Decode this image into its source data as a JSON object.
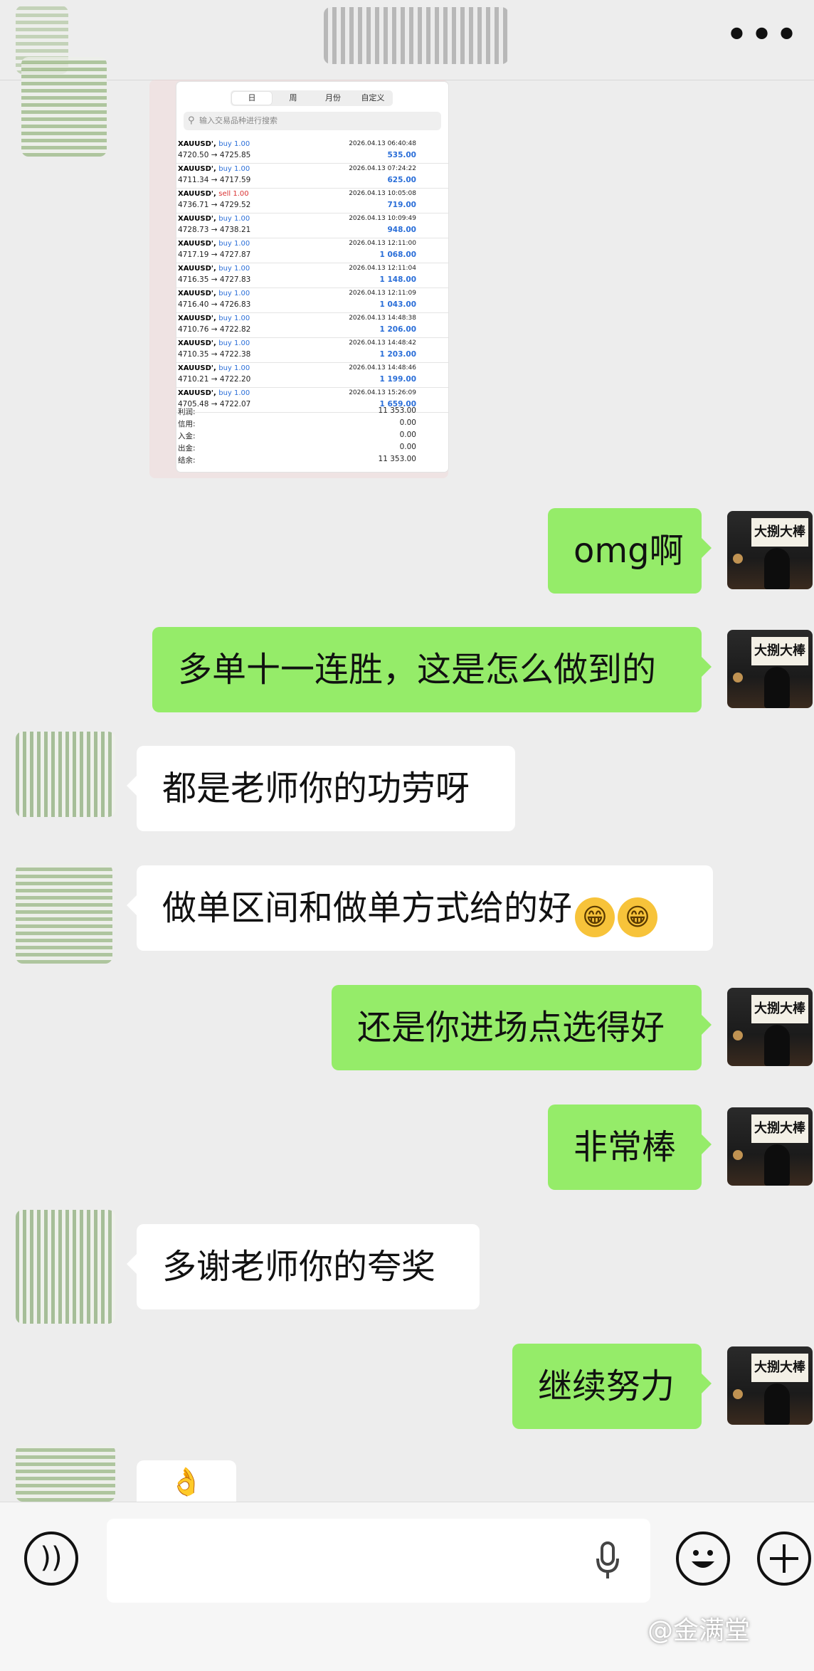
{
  "topbar": {
    "more_icon": "more-dots-icon",
    "more_label": "•••"
  },
  "trade_image": {
    "tabs": [
      "日",
      "周",
      "月份",
      "自定义"
    ],
    "search_placeholder": "输入交易品种进行搜索",
    "trades": [
      {
        "symbol": "XAUUSD',",
        "side": "buy 1.00",
        "prices": "4720.50 → 4725.85",
        "time": "2026.04.13 06:40:48",
        "profit": "535.00"
      },
      {
        "symbol": "XAUUSD',",
        "side": "buy 1.00",
        "prices": "4711.34 → 4717.59",
        "time": "2026.04.13 07:24:22",
        "profit": "625.00"
      },
      {
        "symbol": "XAUUSD',",
        "side": "sell 1.00",
        "prices": "4736.71 → 4729.52",
        "time": "2026.04.13 10:05:08",
        "profit": "719.00"
      },
      {
        "symbol": "XAUUSD',",
        "side": "buy 1.00",
        "prices": "4728.73 → 4738.21",
        "time": "2026.04.13 10:09:49",
        "profit": "948.00"
      },
      {
        "symbol": "XAUUSD',",
        "side": "buy 1.00",
        "prices": "4717.19 → 4727.87",
        "time": "2026.04.13 12:11:00",
        "profit": "1 068.00"
      },
      {
        "symbol": "XAUUSD',",
        "side": "buy 1.00",
        "prices": "4716.35 → 4727.83",
        "time": "2026.04.13 12:11:04",
        "profit": "1 148.00"
      },
      {
        "symbol": "XAUUSD',",
        "side": "buy 1.00",
        "prices": "4716.40 → 4726.83",
        "time": "2026.04.13 12:11:09",
        "profit": "1 043.00"
      },
      {
        "symbol": "XAUUSD',",
        "side": "buy 1.00",
        "prices": "4710.76 → 4722.82",
        "time": "2026.04.13 14:48:38",
        "profit": "1 206.00"
      },
      {
        "symbol": "XAUUSD',",
        "side": "buy 1.00",
        "prices": "4710.35 → 4722.38",
        "time": "2026.04.13 14:48:42",
        "profit": "1 203.00"
      },
      {
        "symbol": "XAUUSD',",
        "side": "buy 1.00",
        "prices": "4710.21 → 4722.20",
        "time": "2026.04.13 14:48:46",
        "profit": "1 199.00"
      },
      {
        "symbol": "XAUUSD',",
        "side": "buy 1.00",
        "prices": "4705.48 → 4722.07",
        "time": "2026.04.13 15:26:09",
        "profit": "1 659.00"
      }
    ],
    "summary": [
      {
        "label": "利润:",
        "value": "11 353.00"
      },
      {
        "label": "信用:",
        "value": "0.00"
      },
      {
        "label": "入金:",
        "value": "0.00"
      },
      {
        "label": "出金:",
        "value": "0.00"
      },
      {
        "label": "结余:",
        "value": "11 353.00"
      }
    ]
  },
  "my_avatar_sign": "大捌大棒",
  "messages": [
    {
      "from": "me",
      "text": "omg啊"
    },
    {
      "from": "me",
      "text": "多单十一连胜，这是怎么做到的"
    },
    {
      "from": "other",
      "text": "都是老师你的功劳呀"
    },
    {
      "from": "other",
      "text": "做单区间和做单方式给的好",
      "emoji": "😁"
    },
    {
      "from": "me",
      "text": "还是你进场点选得好"
    },
    {
      "from": "me",
      "text": "非常棒"
    },
    {
      "from": "other",
      "text": "多谢老师你的夸奖"
    },
    {
      "from": "me",
      "text": "继续努力"
    },
    {
      "from": "other",
      "text": "👌"
    }
  ],
  "input_bar": {
    "voice_icon": "voice-icon",
    "mic_icon": "microphone-icon",
    "emoji_icon": "emoji-icon",
    "plus_icon": "plus-icon"
  },
  "watermark": "@金满堂",
  "colors": {
    "my_bubble": "#95ec69",
    "other_bubble": "#ffffff",
    "background": "#ededed",
    "profit_blue": "#2a6ed8",
    "sell_red": "#d93030"
  }
}
